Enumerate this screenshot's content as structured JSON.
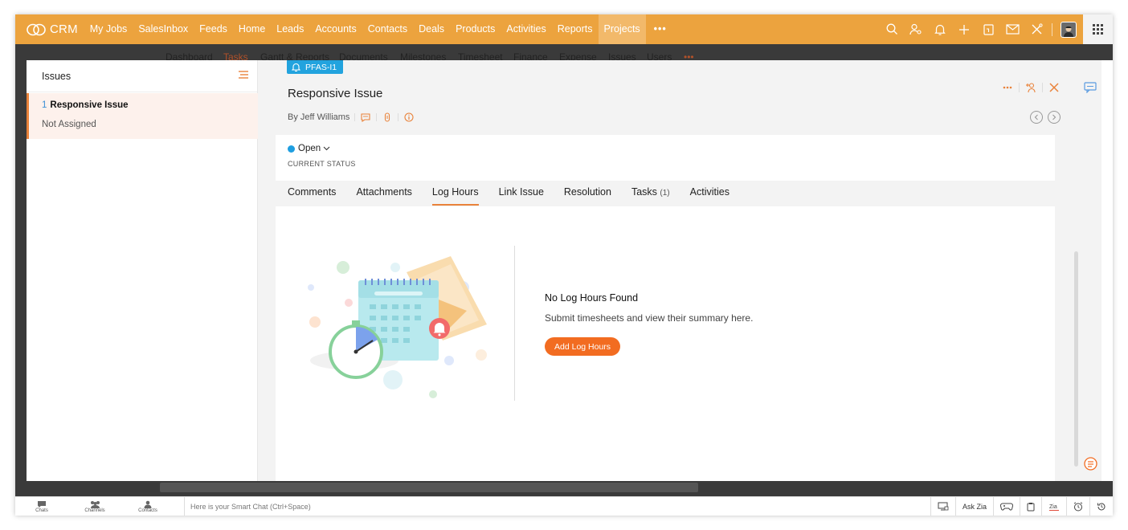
{
  "nav": {
    "brand": "CRM",
    "items": [
      "My Jobs",
      "SalesInbox",
      "Feeds",
      "Home",
      "Leads",
      "Accounts",
      "Contacts",
      "Deals",
      "Products",
      "Activities",
      "Reports",
      "Projects"
    ],
    "active": "Projects",
    "more": "•••",
    "accent": "#eca33e"
  },
  "bg_tabs": [
    "Dashboard",
    "Tasks",
    "Gantt & Reports",
    "Documents",
    "Milestones",
    "Timesheet",
    "Finance",
    "Expense",
    "Issues",
    "Users",
    "•••"
  ],
  "issues_panel": {
    "heading": "Issues",
    "item": {
      "number": "1",
      "title": "Responsive Issue",
      "assignee": "Not Assigned"
    }
  },
  "issue": {
    "id_badge": "PFAS-I1",
    "title": "Responsive Issue",
    "byline": "By Jeff Williams",
    "status": "Open",
    "status_label": "CURRENT STATUS",
    "status_color": "#1e9ee0"
  },
  "tabs": [
    {
      "label": "Comments"
    },
    {
      "label": "Attachments"
    },
    {
      "label": "Log Hours",
      "active": true
    },
    {
      "label": "Link Issue"
    },
    {
      "label": "Resolution"
    },
    {
      "label": "Tasks",
      "count": "(1)"
    },
    {
      "label": "Activities"
    }
  ],
  "empty_state": {
    "title": "No Log Hours Found",
    "subtitle": "Submit timesheets and view their summary here.",
    "button": "Add Log Hours",
    "button_color": "#f26c21"
  },
  "bottom_bar": {
    "chats": "Chats",
    "channels": "Channels",
    "contacts": "Contacts",
    "smart_chat": "Here is your Smart Chat (Ctrl+Space)",
    "ask_zia": "Ask Zia"
  }
}
